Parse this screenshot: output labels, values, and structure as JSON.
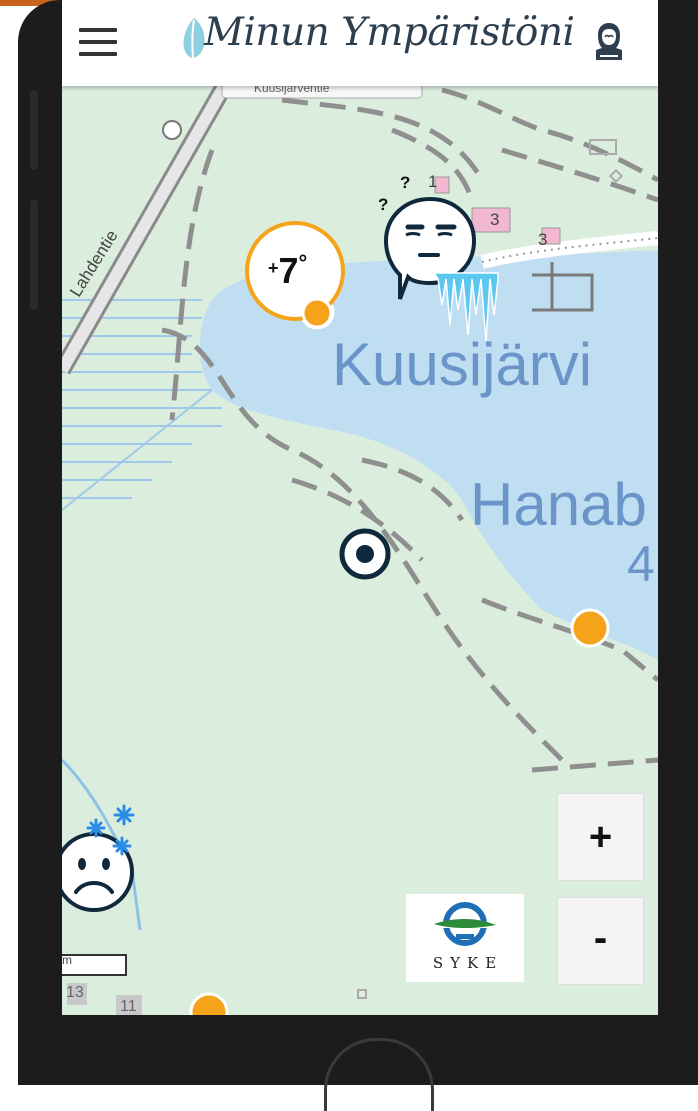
{
  "app": {
    "title": "Minun Ympäristöni",
    "brand_color": "#2d3f4f",
    "accent_color": "#f5a31a"
  },
  "header": {
    "menu_icon": "hamburger-menu-icon",
    "logo_text": "Minun Ympäristöni",
    "user_icon": "user-profile-icon"
  },
  "map": {
    "lake_name": "Kuusijärvi",
    "lake_name_2": "Hanab",
    "lake_number": "4",
    "road_name": "Lahdentie",
    "road_name_top": "Kuusijärventie",
    "building_numbers": [
      "1",
      "3",
      "3",
      "13",
      "11"
    ],
    "question_marks": [
      "?",
      "?"
    ],
    "scale_label": "m"
  },
  "markers": {
    "temperature": {
      "sign": "+",
      "value": "7",
      "unit": "°",
      "icon": "temperature-marker-icon"
    },
    "unimpressed_face": {
      "icon": "unimpressed-face-icicles-icon"
    },
    "cold_sad_face": {
      "icon": "cold-sad-face-icon"
    },
    "current_location": {
      "icon": "current-location-icon"
    }
  },
  "controls": {
    "zoom_in_label": "+",
    "zoom_out_label": "-"
  },
  "partner": {
    "name": "SYKE"
  }
}
